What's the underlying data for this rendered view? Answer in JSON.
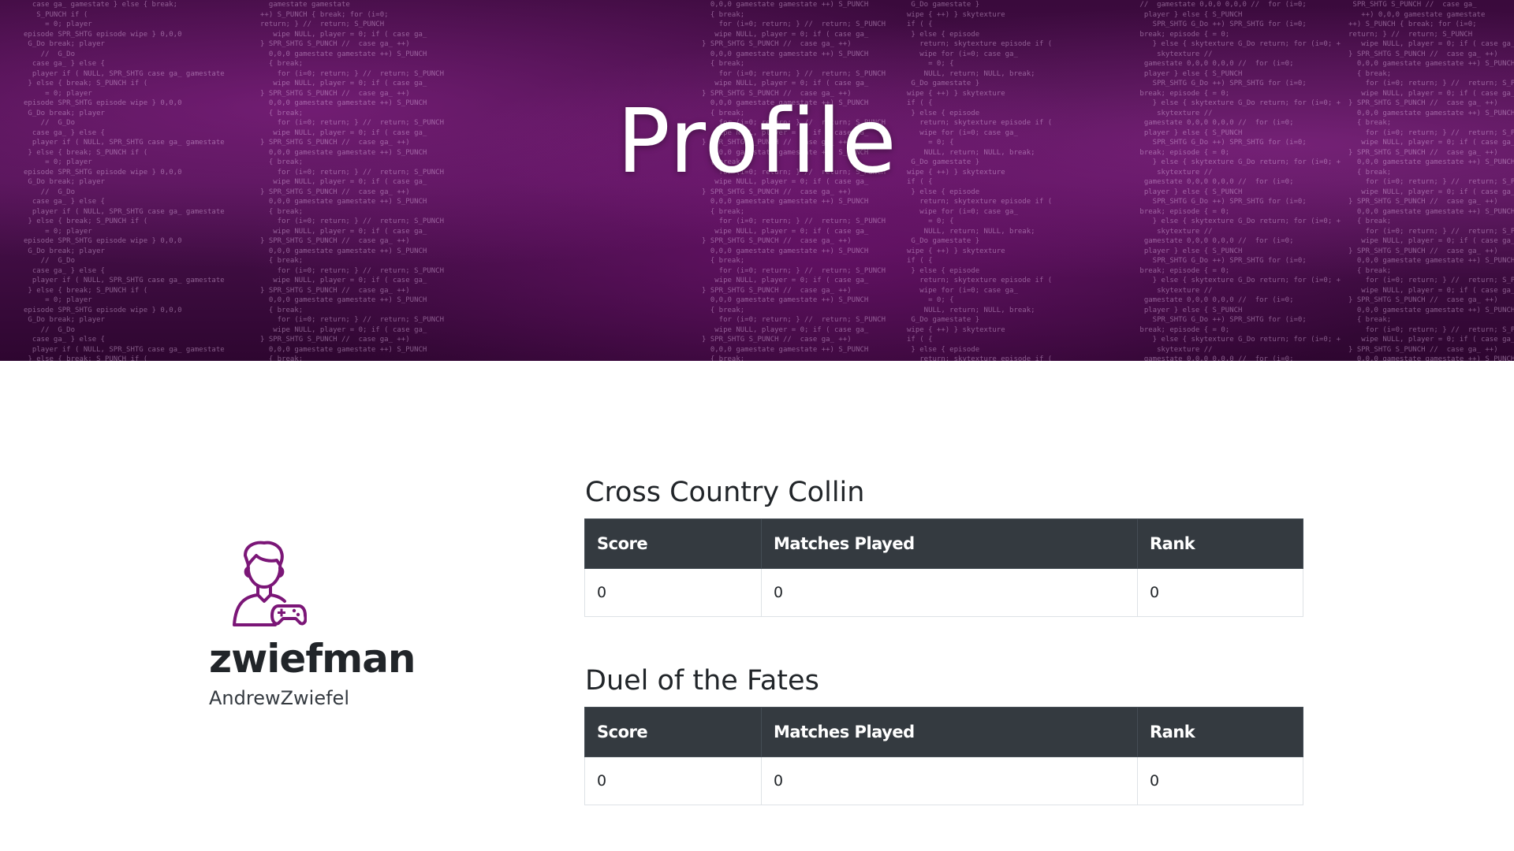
{
  "header": {
    "title": "Profile",
    "background_color": "#4c124f"
  },
  "profile": {
    "avatar_icon": "gamer-avatar-icon",
    "avatar_color": "#7b1677",
    "username": "zwiefman",
    "real_name": "AndrewZwiefel"
  },
  "games": [
    {
      "title": "Cross Country Collin",
      "columns": [
        "Score",
        "Matches Played",
        "Rank"
      ],
      "row": [
        "0",
        "0",
        "0"
      ]
    },
    {
      "title": "Duel of the Fates",
      "columns": [
        "Score",
        "Matches Played",
        "Rank"
      ],
      "row": [
        "0",
        "0",
        "0"
      ]
    }
  ]
}
